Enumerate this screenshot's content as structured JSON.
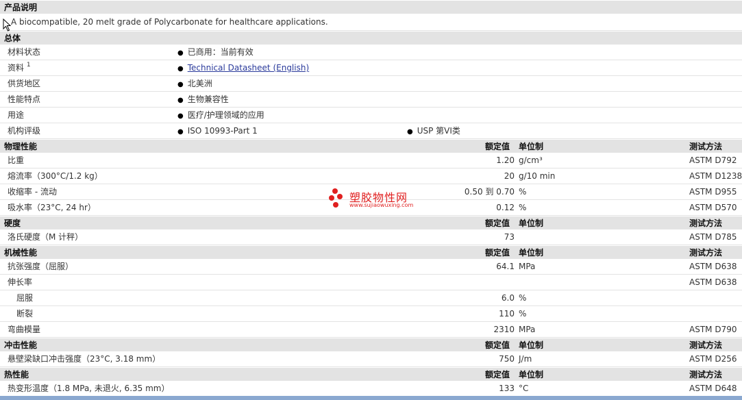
{
  "sections": {
    "description": {
      "title": "产品说明",
      "text": "A biocompatible, 20 melt grade of Polycarbonate for healthcare applications."
    },
    "general": {
      "title": "总体",
      "rows": [
        {
          "label": "材料状态",
          "values": [
            "已商用：当前有效"
          ]
        },
        {
          "label": "资料",
          "sup": "1",
          "values": [
            "Technical Datasheet (English)"
          ]
        },
        {
          "label": "供货地区",
          "values": [
            "北美洲"
          ]
        },
        {
          "label": "性能特点",
          "values": [
            "生物兼容性"
          ]
        },
        {
          "label": "用途",
          "values": [
            "医疗/护理领域的应用"
          ]
        },
        {
          "label": "机构评级",
          "values": [
            "ISO 10993-Part 1",
            "USP 第VI类"
          ]
        }
      ]
    },
    "header_cols": {
      "nominal": "额定值",
      "unit": "单位制",
      "test": "测试方法"
    },
    "physical": {
      "title": "物理性能",
      "rows": [
        {
          "label": "比重",
          "value": "1.20",
          "unit": "g/cm³",
          "test": "ASTM D792"
        },
        {
          "label": "熔流率（300°C/1.2 kg）",
          "value": "20",
          "unit": "g/10 min",
          "test": "ASTM D1238"
        },
        {
          "label": "收缩率 - 流动",
          "value": "0.50 到  0.70",
          "unit": "%",
          "test": "ASTM D955"
        },
        {
          "label": "吸水率（23°C, 24 hr）",
          "value": "0.12",
          "unit": "%",
          "test": "ASTM D570"
        }
      ]
    },
    "hardness": {
      "title": "硬度",
      "rows": [
        {
          "label": "洛氏硬度（M 计秤）",
          "value": "73",
          "unit": "",
          "test": "ASTM D785"
        }
      ]
    },
    "mechanical": {
      "title": "机械性能",
      "rows": [
        {
          "label": "抗张强度（屈服）",
          "value": "64.1",
          "unit": "MPa",
          "test": "ASTM D638"
        },
        {
          "label": "伸长率",
          "value": "",
          "unit": "",
          "test": "ASTM D638"
        },
        {
          "label": "屈服",
          "value": "6.0",
          "unit": "%",
          "test": ""
        },
        {
          "label": "断裂",
          "value": "110",
          "unit": "%",
          "test": ""
        },
        {
          "label": "弯曲模量",
          "value": "2310",
          "unit": "MPa",
          "test": "ASTM D790"
        }
      ]
    },
    "impact": {
      "title": "冲击性能",
      "rows": [
        {
          "label": "悬壁梁缺口冲击强度（23°C, 3.18 mm）",
          "value": "750",
          "unit": "J/m",
          "test": "ASTM D256"
        }
      ]
    },
    "thermal": {
      "title": "热性能",
      "rows": [
        {
          "label": "热变形温度（1.8 MPa, 未退火, 6.35 mm）",
          "value": "133",
          "unit": "°C",
          "test": "ASTM D648"
        }
      ]
    }
  },
  "watermark": {
    "name": "塑胶物性网",
    "url": "www.sujiaowuxing.com",
    "color": "#e02020"
  }
}
